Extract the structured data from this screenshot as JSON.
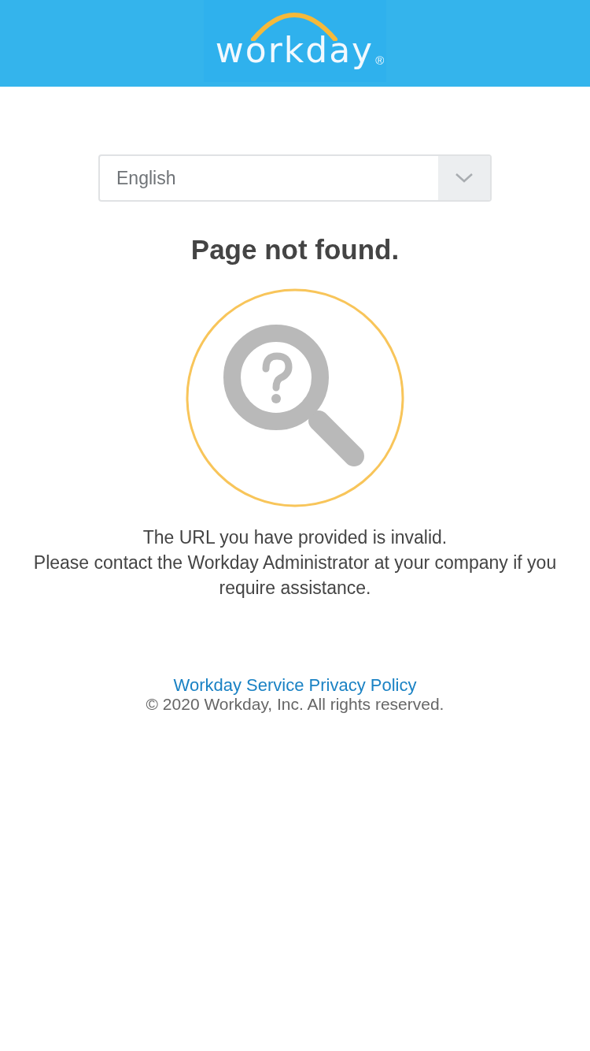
{
  "header": {
    "logo_text": "workday",
    "logo_mark": "®"
  },
  "language_select": {
    "value": "English"
  },
  "heading": "Page not found.",
  "messages": [
    "The URL you have provided is invalid.",
    "Please contact the Workday Administrator at your company if you require assistance."
  ],
  "footer": {
    "link": "Workday Service Privacy Policy",
    "copyright": "© 2020 Workday, Inc. All rights reserved."
  }
}
